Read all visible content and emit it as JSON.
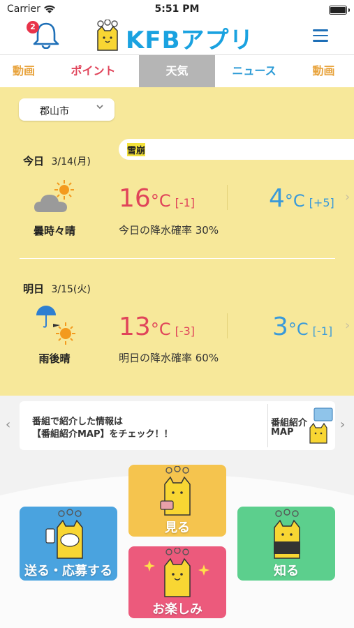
{
  "status_bar": {
    "carrier": "Carrier",
    "time": "5:51 PM"
  },
  "header": {
    "notification_count": "2",
    "logo_text": "KFBアプリ"
  },
  "tabs": [
    {
      "label": "動画",
      "color": "#e8a33c",
      "active": false
    },
    {
      "label": "ポイント",
      "color": "#e0445a",
      "active": false
    },
    {
      "label": "天気",
      "color": "#ffffff",
      "active": true
    },
    {
      "label": "ニュース",
      "color": "#2a9ad6",
      "active": false
    },
    {
      "label": "動画",
      "color": "#e8a33c",
      "active": false
    }
  ],
  "weather": {
    "city": "郡山市",
    "ticker": "雪崩",
    "today": {
      "day_label": "今日",
      "date": "3/14(月)",
      "condition": "曇時々晴",
      "high": "16",
      "high_diff": "[-1]",
      "low": "4",
      "low_diff": "[+5]",
      "rain": "今日の降水確率 30%"
    },
    "tomorrow": {
      "day_label": "明日",
      "date": "3/15(火)",
      "condition": "雨後晴",
      "high": "13",
      "high_diff": "[-3]",
      "low": "3",
      "low_diff": "[-1]",
      "rain": "明日の降水確率 60%"
    },
    "temp_unit": "°C"
  },
  "banner": {
    "line1": "番組で紹介した情報は",
    "line2": "【番組紹介MAP】をチェック！！",
    "map_line1": "番組紹介",
    "map_line2": "MAP"
  },
  "menu_tiles": {
    "see": {
      "label": "見る",
      "color": "#f5c44e"
    },
    "send": {
      "label": "送る・応募する",
      "color": "#4aa3df"
    },
    "know": {
      "label": "知る",
      "color": "#5ccf8d"
    },
    "fun": {
      "label": "お楽しみ",
      "color": "#ec5a7c"
    }
  },
  "colors": {
    "weather_bg": "#f7e89a",
    "high_temp": "#e0445a",
    "low_temp": "#3a9ad9",
    "brand_blue": "#1aa2e0"
  }
}
